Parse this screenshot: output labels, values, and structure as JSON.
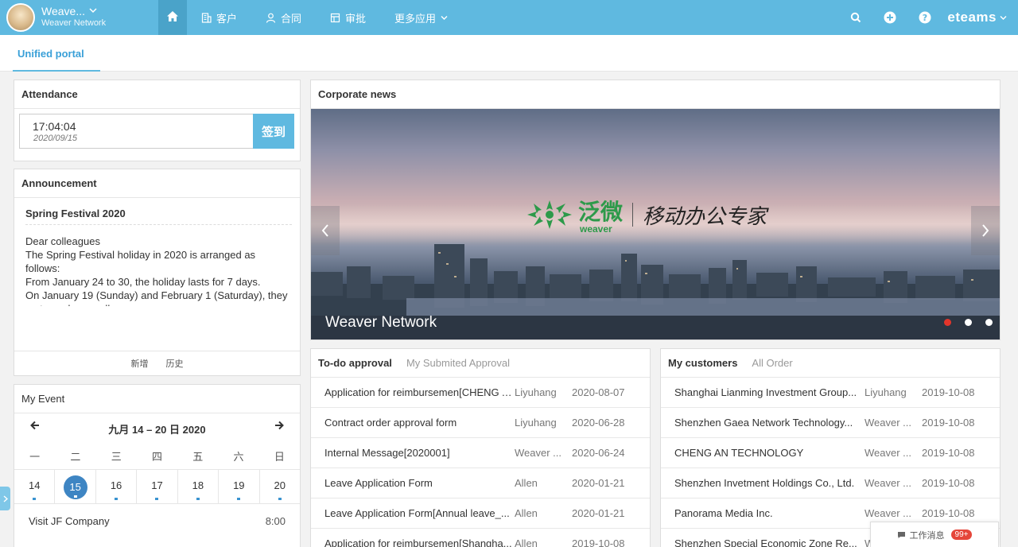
{
  "header": {
    "company_short": "Weave...",
    "company_full": "Weaver Network",
    "nav": [
      {
        "label": ""
      },
      {
        "label": "客户"
      },
      {
        "label": "合同"
      },
      {
        "label": "审批"
      },
      {
        "label": "更多应用"
      }
    ],
    "logo": "eteams"
  },
  "tabs": {
    "active": "Unified portal"
  },
  "attendance": {
    "title": "Attendance",
    "time": "17:04:04",
    "date": "2020/09/15",
    "checkin_label": "签到"
  },
  "announcement": {
    "title": "Announcement",
    "item_title": "Spring Festival 2020",
    "body": "Dear colleagues\nThe Spring Festival holiday in 2020 is arranged as follows:\nFrom January 24 to 30, the holiday lasts for 7 days.\nOn January 19 (Sunday) and February 1 (Saturday), they go to work normally.\nPlease check and close the equipment and take good care of personal property before returning.",
    "add_label": "新增",
    "history_label": "历史"
  },
  "event": {
    "title": "My Event",
    "range": "九月 14 – 20 日  2020",
    "weekdays": [
      "一",
      "二",
      "三",
      "四",
      "五",
      "六",
      "日"
    ],
    "days": [
      "14",
      "15",
      "16",
      "17",
      "18",
      "19",
      "20"
    ],
    "selected_day": "15",
    "item": {
      "name": "Visit JF Company",
      "time": "8:00"
    }
  },
  "news": {
    "title": "Corporate news",
    "brand_cn": "泛微",
    "brand_en": "weaver",
    "slogan": "移动办公专家",
    "caption": "Weaver Network"
  },
  "approval": {
    "title": "To-do approval",
    "tab2": "My Submited Approval",
    "rows": [
      {
        "name": "Application for reimbursemen[CHENG AN...",
        "user": "Liyuhang",
        "date": "2020-08-07"
      },
      {
        "name": "Contract order approval form",
        "user": "Liyuhang",
        "date": "2020-06-28"
      },
      {
        "name": "Internal Message[2020001]",
        "user": "Weaver ...",
        "date": "2020-06-24"
      },
      {
        "name": "Leave Application Form",
        "user": "Allen",
        "date": "2020-01-21"
      },
      {
        "name": "Leave Application Form[Annual leave_...",
        "user": "Allen",
        "date": "2020-01-21"
      },
      {
        "name": "Application for reimbursemen[Shangha...",
        "user": "Allen",
        "date": "2019-10-08"
      }
    ]
  },
  "customers": {
    "title": "My customers",
    "tab2": "All Order",
    "rows": [
      {
        "name": "Shanghai Lianming Investment Group...",
        "user": "Liyuhang",
        "date": "2019-10-08"
      },
      {
        "name": "Shenzhen Gaea Network Technology...",
        "user": "Weaver ...",
        "date": "2019-10-08"
      },
      {
        "name": "CHENG AN TECHNOLOGY",
        "user": "Weaver ...",
        "date": "2019-10-08"
      },
      {
        "name": "Shenzhen Invetment Holdings Co., Ltd.",
        "user": "Weaver ...",
        "date": "2019-10-08"
      },
      {
        "name": "Panorama Media Inc.",
        "user": "Weaver ...",
        "date": "2019-10-08"
      },
      {
        "name": "Shenzhen Special Economic Zone Re...",
        "user": "W",
        "date": ""
      }
    ]
  },
  "messages": {
    "label": "工作消息",
    "badge": "99+"
  },
  "colors": {
    "accent": "#5fb9e0",
    "selected_day": "#3e85c3",
    "badge": "#e5463a",
    "active_dot": "#e3352b"
  }
}
